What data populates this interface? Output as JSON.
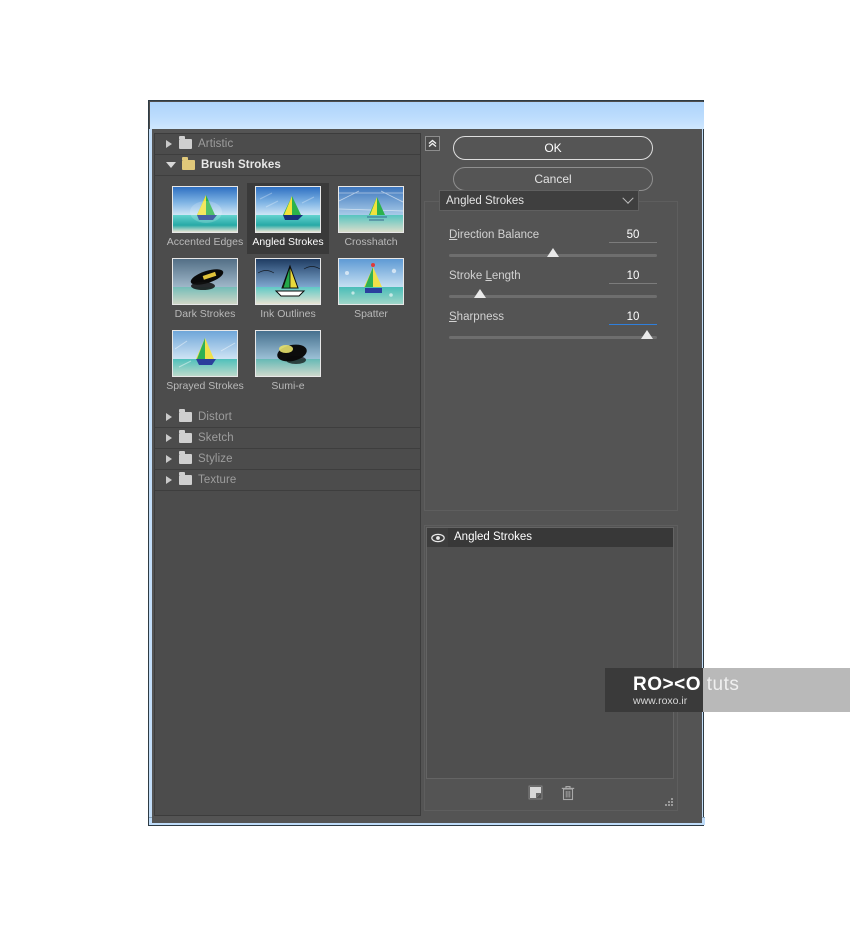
{
  "window": {
    "title": "",
    "collapse_icon": "double-chevron-up-icon"
  },
  "left_panel": {
    "categories": [
      {
        "label": "Artistic",
        "expanded": false
      },
      {
        "label": "Brush Strokes",
        "expanded": true
      },
      {
        "label": "Distort",
        "expanded": false
      },
      {
        "label": "Sketch",
        "expanded": false
      },
      {
        "label": "Stylize",
        "expanded": false
      },
      {
        "label": "Texture",
        "expanded": false
      }
    ],
    "filters": [
      {
        "label": "Accented Edges",
        "selected": false
      },
      {
        "label": "Angled Strokes",
        "selected": true
      },
      {
        "label": "Crosshatch",
        "selected": false
      },
      {
        "label": "Dark Strokes",
        "selected": false
      },
      {
        "label": "Ink Outlines",
        "selected": false
      },
      {
        "label": "Spatter",
        "selected": false
      },
      {
        "label": "Sprayed Strokes",
        "selected": false
      },
      {
        "label": "Sumi-e",
        "selected": false
      }
    ]
  },
  "right_panel": {
    "ok_label": "OK",
    "cancel_label": "Cancel",
    "filter_select": {
      "value": "Angled Strokes",
      "icon": "chevron-down-icon"
    },
    "sliders": [
      {
        "label_pre": "D",
        "label_post": "irection Balance",
        "value": "50",
        "percent": 50,
        "focused": false
      },
      {
        "label_pre": "",
        "label_post": "Stroke ",
        "label_mid": "L",
        "label_end": "ength",
        "value": "10",
        "percent": 15,
        "focused": false
      },
      {
        "label_pre": "S",
        "label_post": "harpness",
        "value": "10",
        "percent": 95,
        "focused": true
      }
    ],
    "layers": [
      {
        "name": "Angled Strokes",
        "visible": true,
        "icon": "eye-icon"
      }
    ],
    "tools": [
      {
        "name": "new-effect-layer-icon",
        "label": "New effect layer"
      },
      {
        "name": "delete-effect-layer-icon",
        "label": "Delete effect layer"
      }
    ],
    "resize_grip": "resize-grip-icon"
  },
  "watermark": {
    "brand_bold": "RO><O",
    "brand_light": " tuts",
    "url": "www.roxo.ir"
  },
  "colors": {
    "window_bg": "#4e4e4e",
    "panel_bg": "#545454",
    "titlebar": "#bcdcfd",
    "accent_blue": "#2f7fdc",
    "selected_cell": "#3a3a3a",
    "text": "#d2d2d2"
  }
}
